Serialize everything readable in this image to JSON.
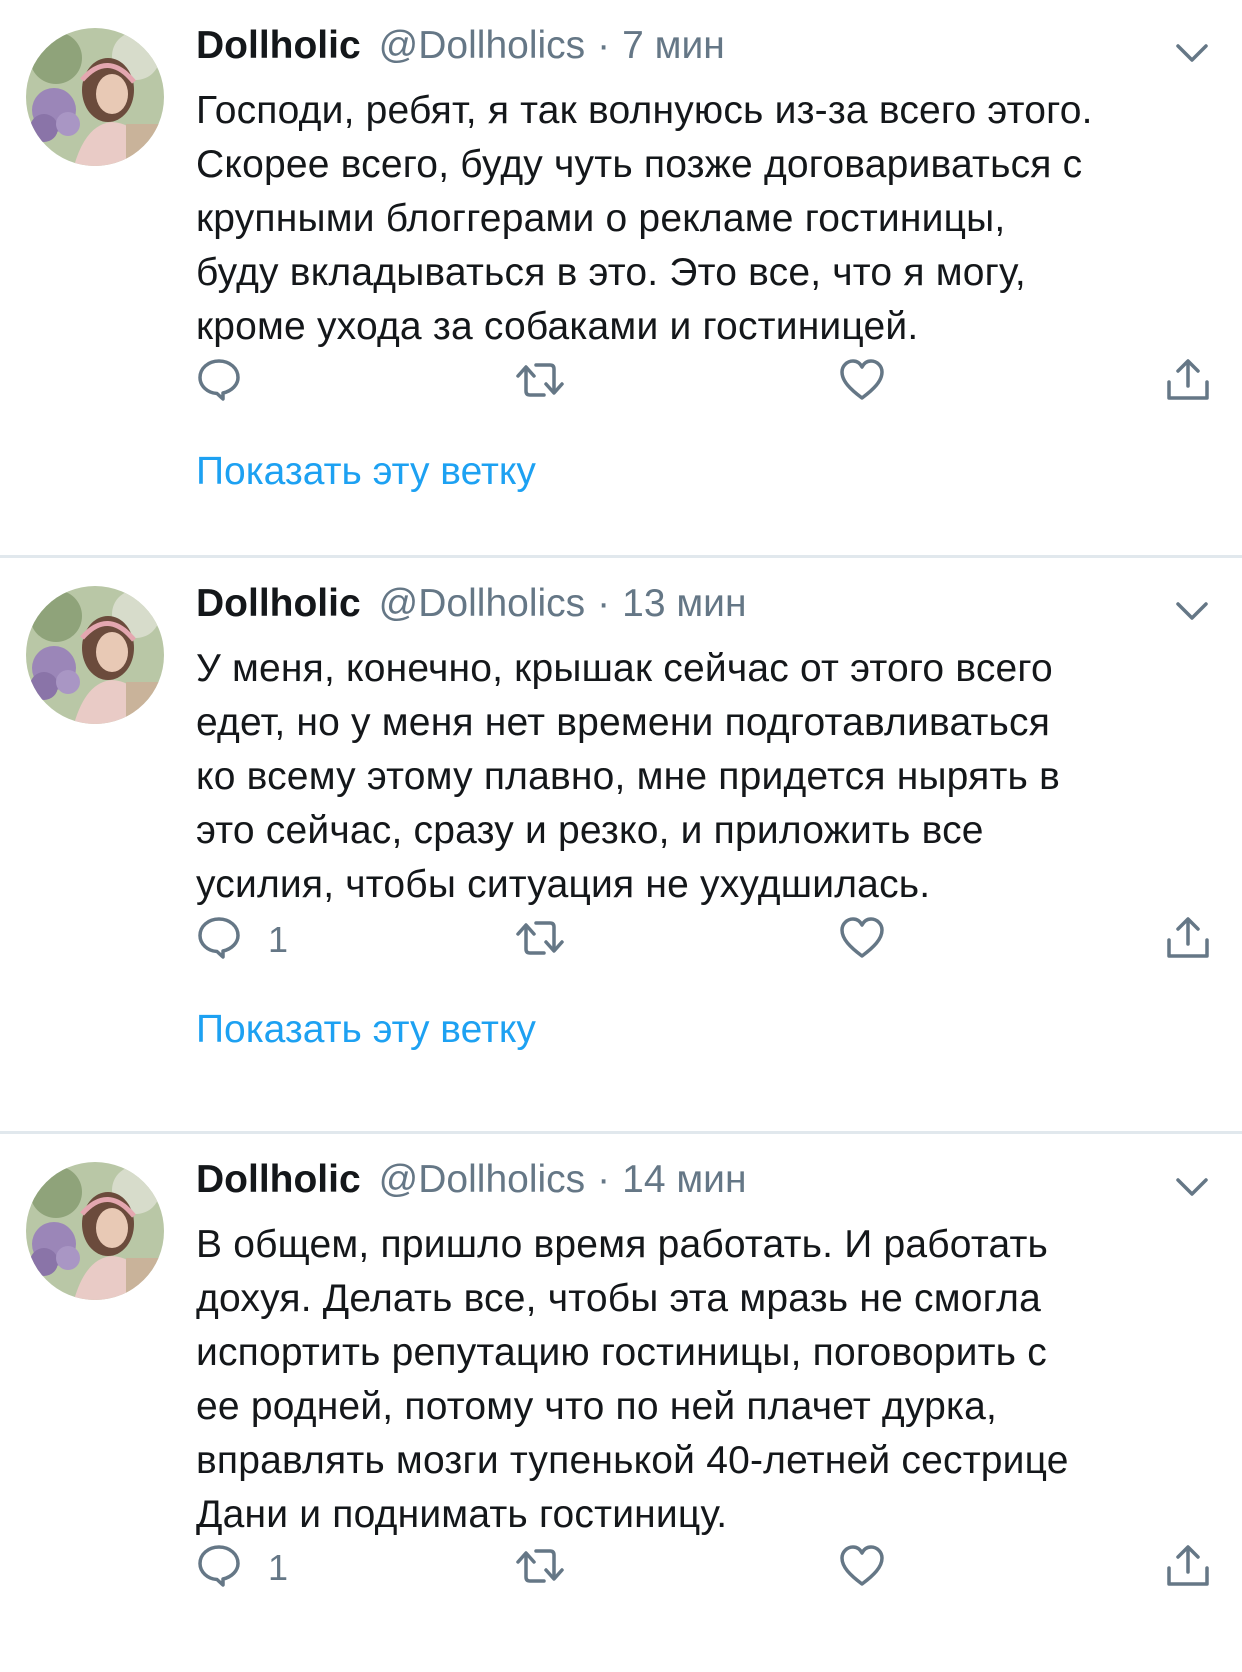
{
  "tweets": [
    {
      "author": {
        "name": "Dollholic",
        "handle": "@Dollholics"
      },
      "separator": "·",
      "time": "7 мин",
      "text": "Господи, ребят, я так волнуюсь из-за всего этого.\nСкорее всего, буду чуть позже договариваться с\nкрупными блоггерами о рекламе гостиницы,\nбуду вкладываться в это. Это все, что я могу,\nкроме ухода за собаками и гостиницей.",
      "reply_count": "",
      "retweet_count": "",
      "like_count": "",
      "show_thread": "Показать эту ветку"
    },
    {
      "author": {
        "name": "Dollholic",
        "handle": "@Dollholics"
      },
      "separator": "·",
      "time": "13 мин",
      "text": "У меня, конечно, крышак сейчас от этого всего\nедет, но у меня нет времени  подготавливаться\nко всему этому плавно, мне придется нырять в\nэто сейчас,  сразу и резко, и приложить все\nусилия, чтобы ситуация не ухудшилась.",
      "reply_count": "1",
      "retweet_count": "",
      "like_count": "",
      "show_thread": "Показать эту ветку"
    },
    {
      "author": {
        "name": "Dollholic",
        "handle": "@Dollholics"
      },
      "separator": "·",
      "time": "14 мин",
      "text": "В общем, пришло время работать. И работать\nдохуя. Делать все, чтобы эта мразь не смогла\nиспортить репутацию гостиницы, поговорить с\nее родней,  потому что по ней плачет дурка,\nвправлять мозги тупенькой 40-летней сестрице\nДани и поднимать гостиницу.",
      "reply_count": "1",
      "retweet_count": "",
      "like_count": ""
    }
  ],
  "icons": {
    "reply": "reply-icon",
    "retweet": "retweet-icon",
    "like": "heart-icon",
    "share": "share-icon",
    "caret": "chevron-down-icon",
    "avatar": "avatar"
  },
  "colors": {
    "text": "#14171a",
    "secondary": "#657786",
    "link": "#1da1f2",
    "divider": "#e1e8ed"
  }
}
